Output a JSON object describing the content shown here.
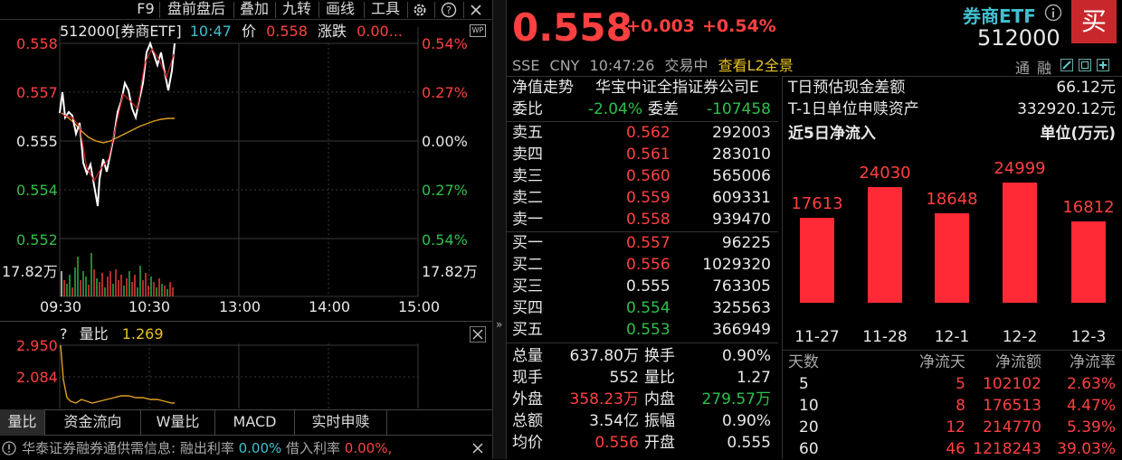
{
  "toolbar": {
    "items": [
      "F9",
      "盘前盘后",
      "叠加",
      "九转",
      "画线",
      "工具"
    ]
  },
  "chart_header": {
    "code_name": "512000[券商ETF]",
    "time": "10:47",
    "price_label": "价",
    "price": "0.558",
    "change_label": "涨跌",
    "change": "0.00..."
  },
  "wp_badge": "WP",
  "left_axis": [
    "0.558",
    "0.557",
    "0.555",
    "0.554",
    "0.552",
    "17.82万"
  ],
  "right_axis": [
    "0.54%",
    "0.27%",
    "0.00%",
    "0.27%",
    "0.54%",
    "17.82万"
  ],
  "time_axis": [
    "09:30",
    "10:30",
    "13:00",
    "14:00",
    "15:00"
  ],
  "sub_chart": {
    "question": "?",
    "label": "量比",
    "value": "1.269",
    "y_labels": [
      "2.950",
      "2.084"
    ]
  },
  "bottom_tabs": [
    "量比",
    "资金流向",
    "W量比",
    "MACD",
    "实时申赎"
  ],
  "status_bar": {
    "text_a": "华泰证券融券通供需信息: 融出利率 ",
    "rate_a": "0.00%",
    "text_b": " 借入利率 ",
    "rate_b": "0.00%,"
  },
  "quote": {
    "price": "0.558",
    "change": "+0.003",
    "change_pct": "+0.54%",
    "exchange": "SSE",
    "currency": "CNY",
    "time": "10:47:26",
    "status": "交易中",
    "l2_link": "查看L2全景"
  },
  "title": {
    "name": "券商ETF",
    "code": "512000",
    "buy_label": "买",
    "tong": "通",
    "rong": "融"
  },
  "nav_row": {
    "label": "净值走势",
    "index": "华宝中证全指证券公司E"
  },
  "committee": {
    "ratio_label": "委比",
    "ratio": "-2.04%",
    "diff_label": "委差",
    "diff": "-107458"
  },
  "sell_orders": [
    {
      "label": "卖五",
      "price": "0.562",
      "volume": "292003"
    },
    {
      "label": "卖四",
      "price": "0.561",
      "volume": "283010"
    },
    {
      "label": "卖三",
      "price": "0.560",
      "volume": "565006"
    },
    {
      "label": "卖二",
      "price": "0.559",
      "volume": "609331"
    },
    {
      "label": "卖一",
      "price": "0.558",
      "volume": "939470"
    }
  ],
  "buy_orders": [
    {
      "label": "买一",
      "price": "0.557",
      "volume": "96225"
    },
    {
      "label": "买二",
      "price": "0.556",
      "volume": "1029320"
    },
    {
      "label": "买三",
      "price": "0.555",
      "volume": "763305"
    },
    {
      "label": "买四",
      "price": "0.554",
      "volume": "325563"
    },
    {
      "label": "买五",
      "price": "0.553",
      "volume": "366949"
    }
  ],
  "stats": [
    {
      "l1": "总量",
      "v1": "637.80万",
      "l2": "换手",
      "v2": "0.90%"
    },
    {
      "l1": "现手",
      "v1": "552",
      "l2": "量比",
      "v2": "1.27"
    },
    {
      "l1": "外盘",
      "v1": "358.23万",
      "l2": "内盘",
      "v2": "279.57万"
    },
    {
      "l1": "总额",
      "v1": "3.54亿",
      "l2": "振幅",
      "v2": "0.90%"
    },
    {
      "l1": "均价",
      "v1": "0.556",
      "l2": "开盘",
      "v2": "0.555"
    }
  ],
  "etf_info": {
    "cash_label": "T日预估现金差额",
    "cash_value": "66.12元",
    "asset_label": "T-1日单位申赎资产",
    "asset_value": "332920.12元",
    "inflow_title": "近5日净流入",
    "unit": "单位(万元)"
  },
  "chart_data": {
    "type": "bar",
    "title": "近5日净流入",
    "categories": [
      "11-27",
      "11-28",
      "12-1",
      "12-2",
      "12-3"
    ],
    "values": [
      17613,
      24030,
      18648,
      24999,
      16812
    ],
    "color": "#ff2a35"
  },
  "flow_table": {
    "headers": [
      "天数",
      "净流天",
      "净流额",
      "净流率"
    ],
    "rows": [
      [
        "5",
        "5",
        "102102",
        "2.63%"
      ],
      [
        "10",
        "8",
        "176513",
        "4.47%"
      ],
      [
        "20",
        "12",
        "214770",
        "5.39%"
      ],
      [
        "60",
        "46",
        "1218243",
        "39.03%"
      ]
    ]
  },
  "colors": {
    "up": "#ff4040",
    "down": "#2ec04a",
    "accent": "#e8c020",
    "link": "#3fc0d0"
  }
}
